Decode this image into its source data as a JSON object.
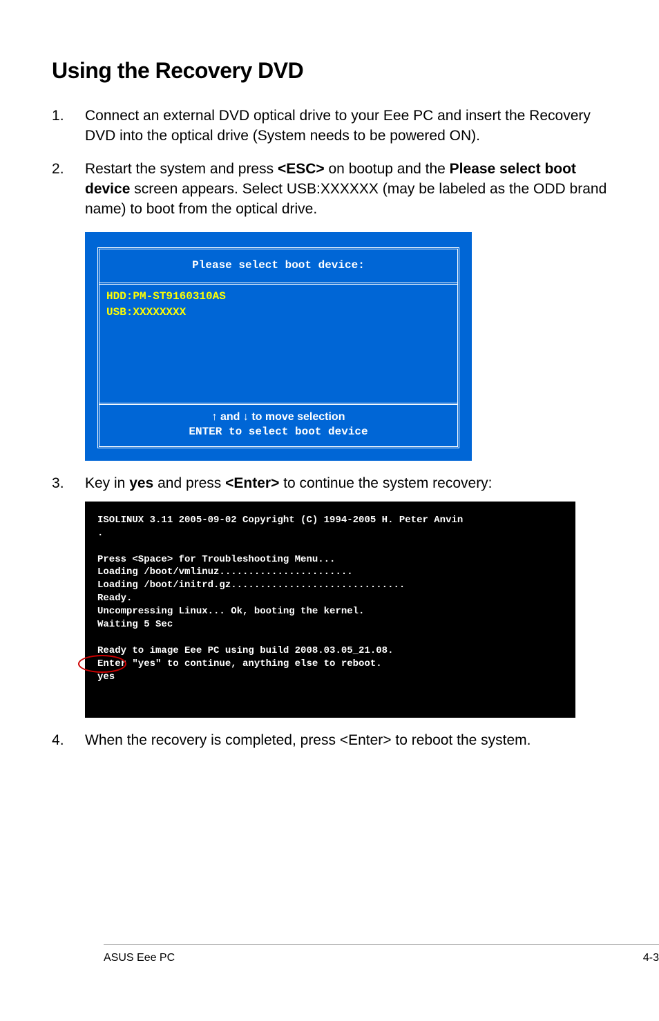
{
  "heading": "Using the Recovery DVD",
  "steps": {
    "s1": "Connect an external DVD optical drive to your Eee PC and insert the Recovery DVD into the optical drive (System needs to be powered ON).",
    "s2_a": "Restart the system and press ",
    "s2_esc": "<ESC>",
    "s2_b": " on bootup and the ",
    "s2_please": "Please select boot device",
    "s2_c": " screen appears. Select USB:XXXXXX (may be labeled as the ODD brand name) to boot from the optical drive.",
    "s3_a": "Key in ",
    "s3_yes": "yes",
    "s3_b": " and press ",
    "s3_enter": "<Enter>",
    "s3_c": " to continue the system recovery:",
    "s4": "When the recovery is completed, press <Enter> to reboot the system."
  },
  "bios": {
    "title": "Please select boot device:",
    "line1": "HDD:PM-ST9160310AS",
    "line2": "USB:XXXXXXXX",
    "footer1": "↑ and ↓ to move selection",
    "footer2": "ENTER to select boot device"
  },
  "terminal": {
    "line1": "ISOLINUX 3.11 2005-09-02 Copyright (C) 1994-2005 H. Peter Anvin",
    "dot": ".",
    "blank": "",
    "line2": "Press <Space> for Troubleshooting Menu...",
    "line3": "Loading /boot/vmlinuz.......................",
    "line4": "Loading /boot/initrd.gz..............................",
    "line5": "Ready.",
    "line6": "Uncompressing Linux... Ok, booting the kernel.",
    "line7": "Waiting 5 Sec",
    "line8": "Ready to image Eee PC using build 2008.03.05_21.08.",
    "line9": "Enter \"yes\" to continue, anything else to reboot.",
    "line10": "yes"
  },
  "footer": {
    "left": "ASUS Eee PC",
    "right": "4-3"
  }
}
